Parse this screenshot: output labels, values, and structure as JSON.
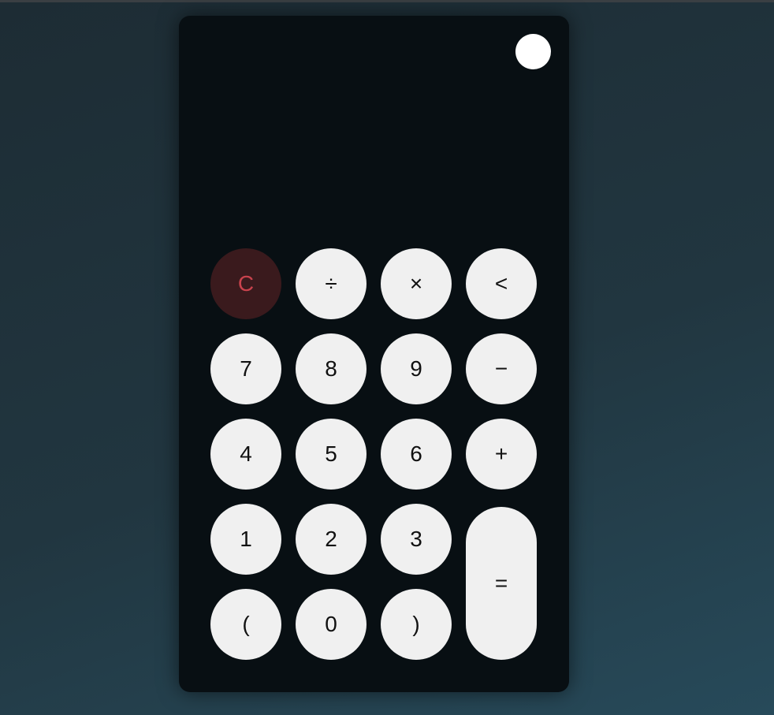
{
  "display": {
    "value": ""
  },
  "theme_toggle": {
    "icon": "circle-icon"
  },
  "keys": {
    "clear": "C",
    "divide": "÷",
    "multiply": "×",
    "backspace": "<",
    "seven": "7",
    "eight": "8",
    "nine": "9",
    "subtract": "−",
    "four": "4",
    "five": "5",
    "six": "6",
    "add": "+",
    "one": "1",
    "two": "2",
    "three": "3",
    "equals": "=",
    "open_paren": "(",
    "zero": "0",
    "close_paren": ")"
  },
  "colors": {
    "background": "#213640",
    "panel": "#080f13",
    "key": "#f0f0f0",
    "clear_key_bg": "#3a1a1d",
    "clear_key_text": "#c9434d"
  }
}
